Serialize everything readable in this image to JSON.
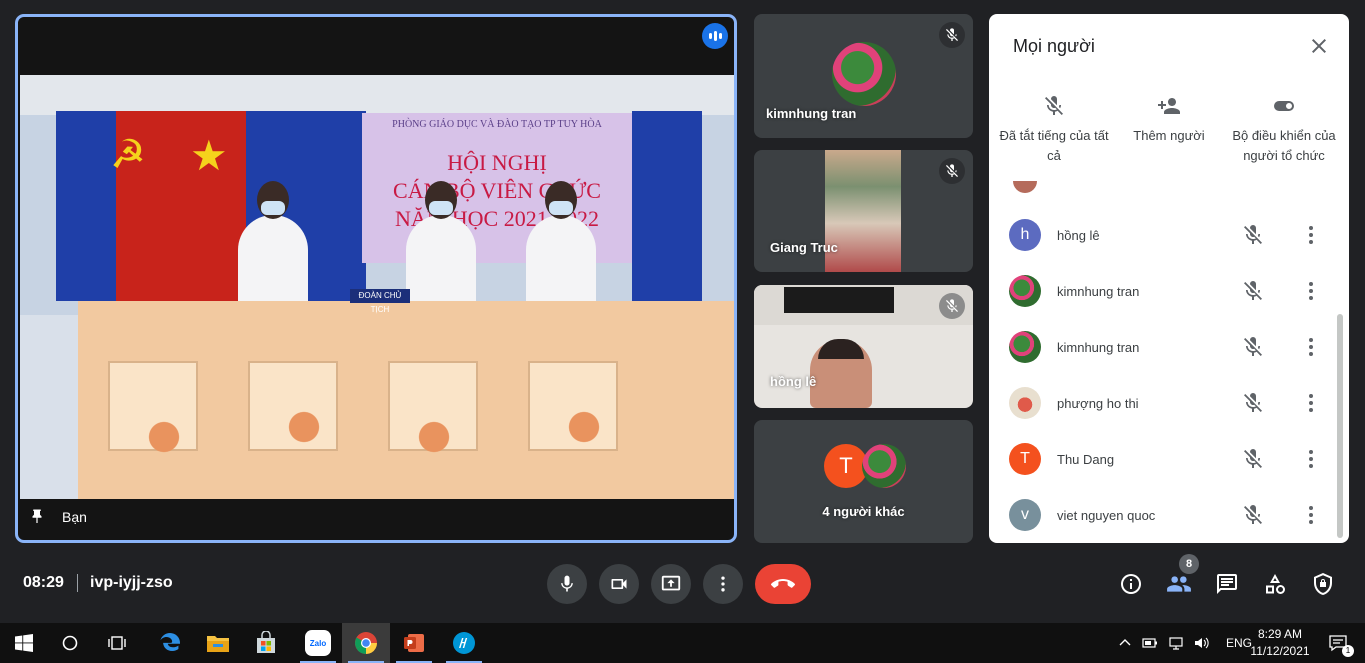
{
  "main_tile": {
    "self_label": "Bạn",
    "banner": {
      "line1": "PHÒNG GIÁO DỤC VÀ ĐÀO TẠO TP TUY HÒA",
      "line2": "HỘI NGHỊ",
      "line3": "CÁN BỘ VIÊN CHỨC",
      "line4": "NĂM HỌC 2021-2022"
    },
    "nameplate": "ĐOÀN CHỦ TỊCH"
  },
  "side_tiles": [
    {
      "name": "kimnhung tran"
    },
    {
      "name": "Giang Truc"
    },
    {
      "name": "hồng lê"
    },
    {
      "name": "4 người khác",
      "avatar_letter": "T",
      "avatar_color": "#f4511e"
    }
  ],
  "people_panel": {
    "title": "Mọi người",
    "actions": [
      {
        "label": "Đã tắt tiếng của tất cả",
        "icon": "mic-off-icon"
      },
      {
        "label": "Thêm người",
        "icon": "person-add-icon"
      },
      {
        "label": "Bộ điều khiển của người tổ chức",
        "icon": "toggle-icon"
      }
    ],
    "participants": [
      {
        "name": "hồng lê",
        "letter": "h",
        "color": "#5c6bc0",
        "photo": false
      },
      {
        "name": "kimnhung tran",
        "letter": "",
        "color": "#2e7d32",
        "photo": true
      },
      {
        "name": "kimnhung tran",
        "letter": "",
        "color": "#2e7d32",
        "photo": true
      },
      {
        "name": "phượng ho thi",
        "letter": "",
        "color": "#a1887f",
        "photo": true
      },
      {
        "name": "Thu Dang",
        "letter": "T",
        "color": "#f4511e",
        "photo": false
      },
      {
        "name": "viet nguyen quoc",
        "letter": "v",
        "color": "#78909c",
        "photo": false
      }
    ]
  },
  "bottom_bar": {
    "time": "08:29",
    "meeting_code": "ivp-iyjj-zso",
    "participant_count": "8",
    "end_call_color": "#ea4335"
  },
  "taskbar": {
    "language": "ENG",
    "clock_time": "8:29 AM",
    "clock_date": "11/12/2021",
    "notification_count": "1",
    "apps": [
      "start-icon",
      "search-icon",
      "task-view-icon",
      "edge-icon",
      "file-explorer-icon",
      "store-icon",
      "zalo-icon",
      "chrome-icon",
      "powerpoint-icon",
      "hp-icon"
    ],
    "zalo_label": "Zalo"
  },
  "colors": {
    "background": "#202124",
    "tile": "#3c4043",
    "accent": "#8ab4f8",
    "meet_blue": "#1a73e8"
  }
}
